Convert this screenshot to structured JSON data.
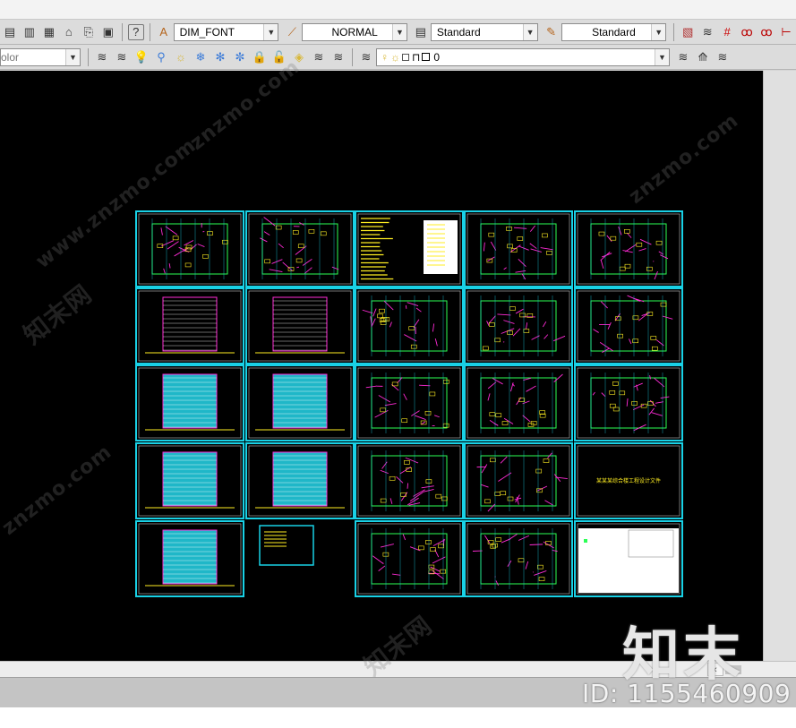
{
  "toolbar1": {
    "text_style_combo": "DIM_FONT",
    "dim_style_combo": "NORMAL",
    "table_style_combo": "Standard",
    "multileader_style_combo": "Standard"
  },
  "toolbar2": {
    "color_combo": "olor",
    "layer_combo": "0"
  },
  "watermarks": {
    "site_1": "www.znzmo.com",
    "site_2": "znzmo.com",
    "site_3": "znzmo.com",
    "site_4": "znzmo.com",
    "mark_1": "知末网",
    "mark_2": "知末网",
    "brand": "知末",
    "id": "ID: 1155460909"
  },
  "drawing": {
    "cover_sheet_title": "某某某综合楼工程设计文件"
  },
  "colors": {
    "sheet_border": "#19d1e6",
    "canvas_bg": "#000000",
    "cad_magenta": "#ff2bd6",
    "cad_green": "#2bff55",
    "cad_yellow": "#ffee22",
    "cad_cyan": "#19d1e6"
  }
}
